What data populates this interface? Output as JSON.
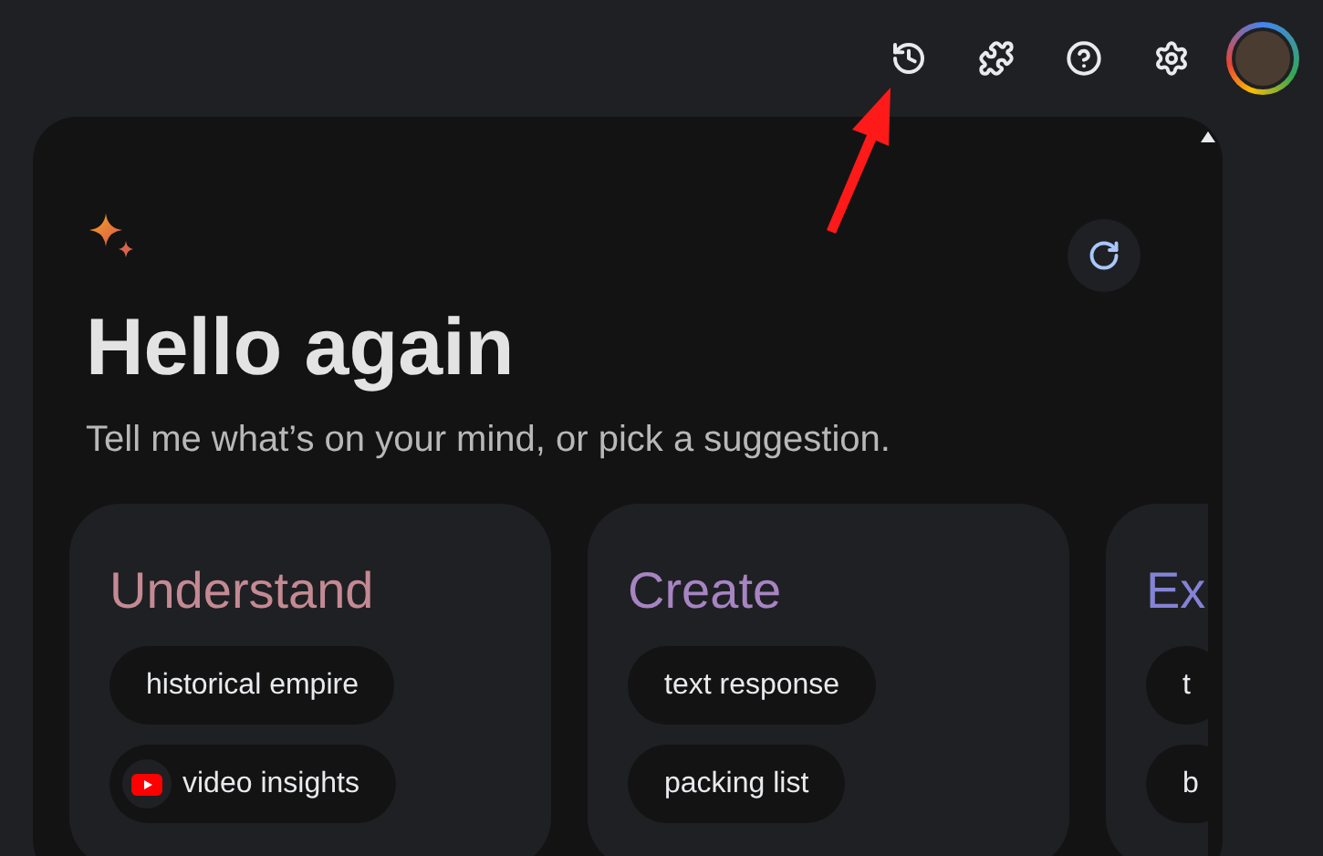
{
  "heading": "Hello again",
  "subtitle": "Tell me what’s on your mind, or pick a suggestion.",
  "cards": [
    {
      "title": "Understand",
      "color": "#c48a93",
      "chips": [
        {
          "kind": "plain",
          "label": "historical empire"
        },
        {
          "kind": "video",
          "label": "video insights"
        }
      ]
    },
    {
      "title": "Create",
      "color": "#a784c2",
      "chips": [
        {
          "kind": "plain",
          "label": "text response"
        },
        {
          "kind": "plain",
          "label": "packing list"
        }
      ]
    },
    {
      "title": "Ex",
      "color": "#8583d6",
      "chips": [
        {
          "kind": "plain",
          "label": "t"
        },
        {
          "kind": "plain",
          "label": "b"
        }
      ]
    }
  ]
}
